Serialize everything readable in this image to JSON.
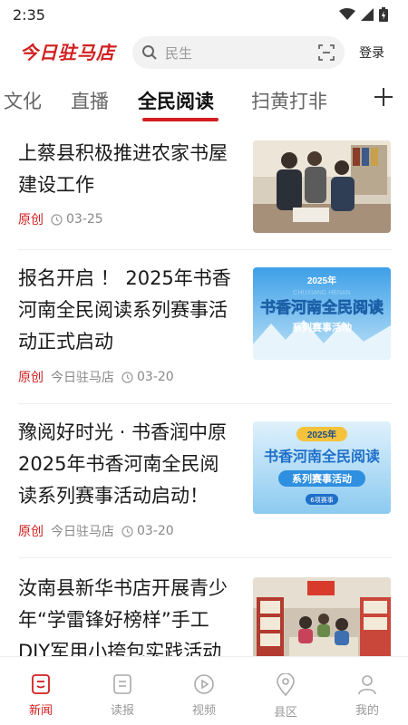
{
  "status": {
    "time": "2:35"
  },
  "header": {
    "logo": "今日驻马店",
    "search_placeholder": "民生",
    "login": "登录"
  },
  "tabs": [
    {
      "label": "文化"
    },
    {
      "label": "直播"
    },
    {
      "label": "全民阅读",
      "active": true
    },
    {
      "label": "扫黄打非"
    }
  ],
  "articles": [
    {
      "title_lines": [
        "上蔡县积极推进农家书屋",
        "建设工作"
      ],
      "tag": "原创",
      "source": "",
      "date": "03-25",
      "thumb_icon": "people-in-bookstore-photo"
    },
    {
      "title_lines": [
        "报名开启 ！ 2025年书香",
        "河南全民阅读系列赛事活",
        "动正式启动"
      ],
      "tag": "原创",
      "source": "今日驻马店",
      "date": "03-20",
      "thumb_text": [
        "2025年",
        "CHUXIANG HENAN",
        "书香河南全民阅读",
        "系列赛事活动"
      ]
    },
    {
      "title_lines": [
        "豫阅好时光 · 书香润中原",
        "2025年书香河南全民阅",
        "读系列赛事活动启动！"
      ],
      "tag": "原创",
      "source": "今日驻马店",
      "date": "03-20",
      "thumb_text": [
        "2025年",
        "书香河南全民阅读",
        "系列赛事活动",
        "6项赛事"
      ]
    },
    {
      "title_lines": [
        "汝南县新华书店开展青少",
        "年“学雷锋好榜样”手工",
        "DIY军用小挎包实践活动"
      ],
      "tag": "",
      "source": "",
      "date": "",
      "thumb_icon": "children-handcraft-photo"
    }
  ],
  "bottom_nav": [
    {
      "label": "新闻",
      "icon": "news-icon",
      "active": true
    },
    {
      "label": "读报",
      "icon": "newspaper-icon"
    },
    {
      "label": "视频",
      "icon": "video-icon"
    },
    {
      "label": "县区",
      "icon": "location-icon"
    },
    {
      "label": "我的",
      "icon": "profile-icon"
    }
  ],
  "colors": {
    "accent": "#d21f1f",
    "thumb_blue": "#2f8fe0"
  }
}
